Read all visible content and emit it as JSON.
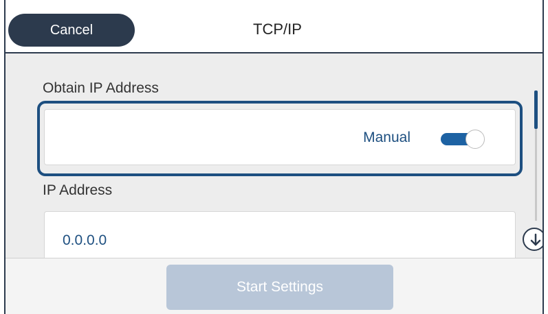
{
  "header": {
    "cancel_label": "Cancel",
    "title": "TCP/IP"
  },
  "obtain_ip": {
    "label": "Obtain IP Address",
    "value": "Manual",
    "toggle_on": true
  },
  "ip_address": {
    "label": "IP Address",
    "value": "0.0.0.0"
  },
  "footer": {
    "start_label": "Start Settings",
    "start_enabled": false
  },
  "colors": {
    "header_dark": "#2c3a4d",
    "accent": "#1d4f80",
    "toggle_on": "#1d62a3",
    "disabled_button": "#b8c6d8"
  },
  "icons": {
    "scroll_down": "arrow-down-circle-icon"
  }
}
